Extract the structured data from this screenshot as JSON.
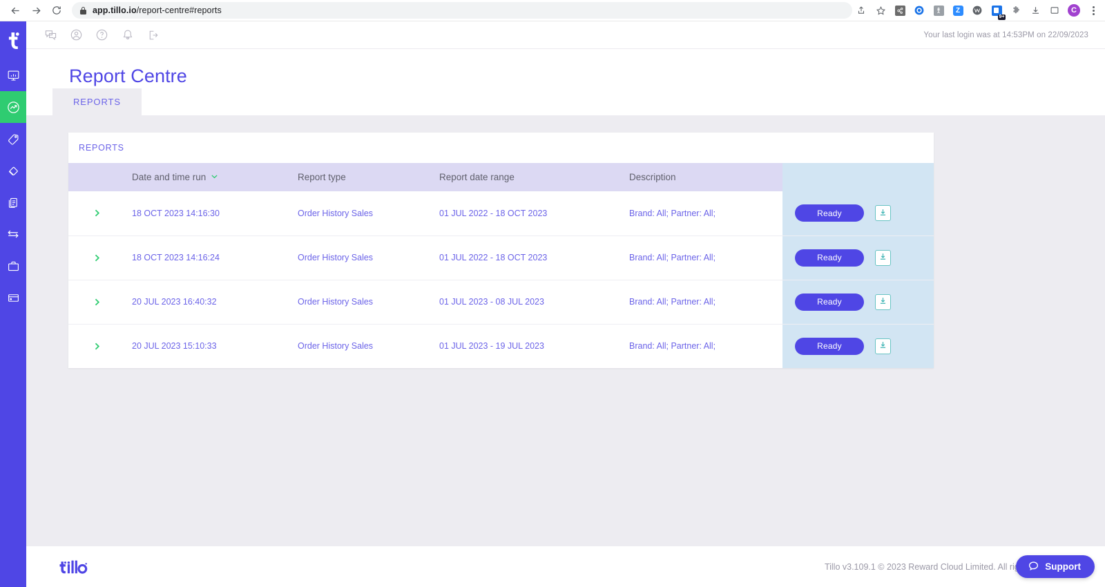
{
  "browser": {
    "url_host": "app.tillo.io",
    "url_path": "/report-centre#reports",
    "back_icon": "back-arrow-icon",
    "forward_icon": "forward-arrow-icon",
    "reload_icon": "reload-icon",
    "lock_icon": "lock-icon",
    "toolbar_icons": [
      {
        "name": "share-icon"
      },
      {
        "name": "bookmark-star-icon"
      },
      {
        "name": "extension-hubspot-icon",
        "color": "#6b6b6b"
      },
      {
        "name": "extension-circle-icon",
        "color": "#1a73e8"
      },
      {
        "name": "extension-gray-icon",
        "color": "#9aa0a6"
      },
      {
        "name": "extension-zoom-icon",
        "color": "#2d8cff"
      },
      {
        "name": "extension-w-icon",
        "color": "#5f6368"
      },
      {
        "name": "extension-notes-icon",
        "color": "#1a73e8",
        "badge": "9+"
      },
      {
        "name": "extensions-puzzle-icon"
      },
      {
        "name": "downloads-icon"
      },
      {
        "name": "sidepanel-icon"
      },
      {
        "name": "profile-avatar",
        "label": "C"
      },
      {
        "name": "chrome-menu-icon"
      }
    ]
  },
  "sidebar": {
    "logo": "tillo-logo-icon",
    "items": [
      {
        "name": "sidebar-item-dashboard",
        "icon": "monitor-chart-icon",
        "active": false
      },
      {
        "name": "sidebar-item-reports",
        "icon": "analytics-circle-icon",
        "active": true
      },
      {
        "name": "sidebar-item-pricing",
        "icon": "tag-icon",
        "active": false
      },
      {
        "name": "sidebar-item-brands",
        "icon": "diamond-cards-icon",
        "active": false
      },
      {
        "name": "sidebar-item-orders",
        "icon": "documents-icon",
        "active": false
      },
      {
        "name": "sidebar-item-transfers",
        "icon": "exchange-arrows-icon",
        "active": false
      },
      {
        "name": "sidebar-item-business",
        "icon": "briefcase-icon",
        "active": false
      },
      {
        "name": "sidebar-item-wallet",
        "icon": "card-wallet-icon",
        "active": false
      }
    ]
  },
  "topbar": {
    "icons": [
      {
        "name": "chat-bubbles-icon"
      },
      {
        "name": "user-circle-icon"
      },
      {
        "name": "help-circle-icon"
      },
      {
        "name": "bell-icon"
      },
      {
        "name": "logout-icon"
      }
    ],
    "last_login": "Your last login was at 14:53PM on 22/09/2023"
  },
  "page": {
    "title": "Report Centre",
    "tabs": [
      {
        "label": "REPORTS",
        "active": true
      }
    ]
  },
  "card": {
    "heading": "REPORTS",
    "columns": [
      {
        "label": ""
      },
      {
        "label": "Date and time run",
        "sort_icon": "chevron-down-icon",
        "sorted": true
      },
      {
        "label": "Report type"
      },
      {
        "label": "Report date range"
      },
      {
        "label": "Description"
      },
      {
        "label": ""
      }
    ],
    "rows": [
      {
        "expand_icon": "chevron-right-icon",
        "date_time_run": "18 OCT 2023 14:16:30",
        "report_type": "Order History Sales",
        "report_date_range": "01 JUL 2022 - 18 OCT 2023",
        "description": "Brand: All; Partner: All;",
        "status_label": "Ready",
        "download_icon": "download-icon"
      },
      {
        "expand_icon": "chevron-right-icon",
        "date_time_run": "18 OCT 2023 14:16:24",
        "report_type": "Order History Sales",
        "report_date_range": "01 JUL 2022 - 18 OCT 2023",
        "description": "Brand: All; Partner: All;",
        "status_label": "Ready",
        "download_icon": "download-icon"
      },
      {
        "expand_icon": "chevron-right-icon",
        "date_time_run": "20 JUL 2023 16:40:32",
        "report_type": "Order History Sales",
        "report_date_range": "01 JUL 2023 - 08 JUL 2023",
        "description": "Brand: All; Partner: All;",
        "status_label": "Ready",
        "download_icon": "download-icon"
      },
      {
        "expand_icon": "chevron-right-icon",
        "date_time_run": "20 JUL 2023 15:10:33",
        "report_type": "Order History Sales",
        "report_date_range": "01 JUL 2023 - 19 JUL 2023",
        "description": "Brand: All; Partner: All;",
        "status_label": "Ready",
        "download_icon": "download-icon"
      }
    ]
  },
  "footer": {
    "logo": "tillo-wordmark-logo",
    "copyright": "Tillo v3.109.1 © 2023 Reward Cloud Limited. All rights reserved.",
    "support_label": "Support",
    "support_icon": "chat-bubble-icon"
  },
  "colors": {
    "brand_purple": "#4f46e5",
    "accent_green": "#2fcc71",
    "header_lavender": "#dcd9f3",
    "action_blue": "#d2e5f3",
    "teal_outline": "#3bb3b3"
  }
}
